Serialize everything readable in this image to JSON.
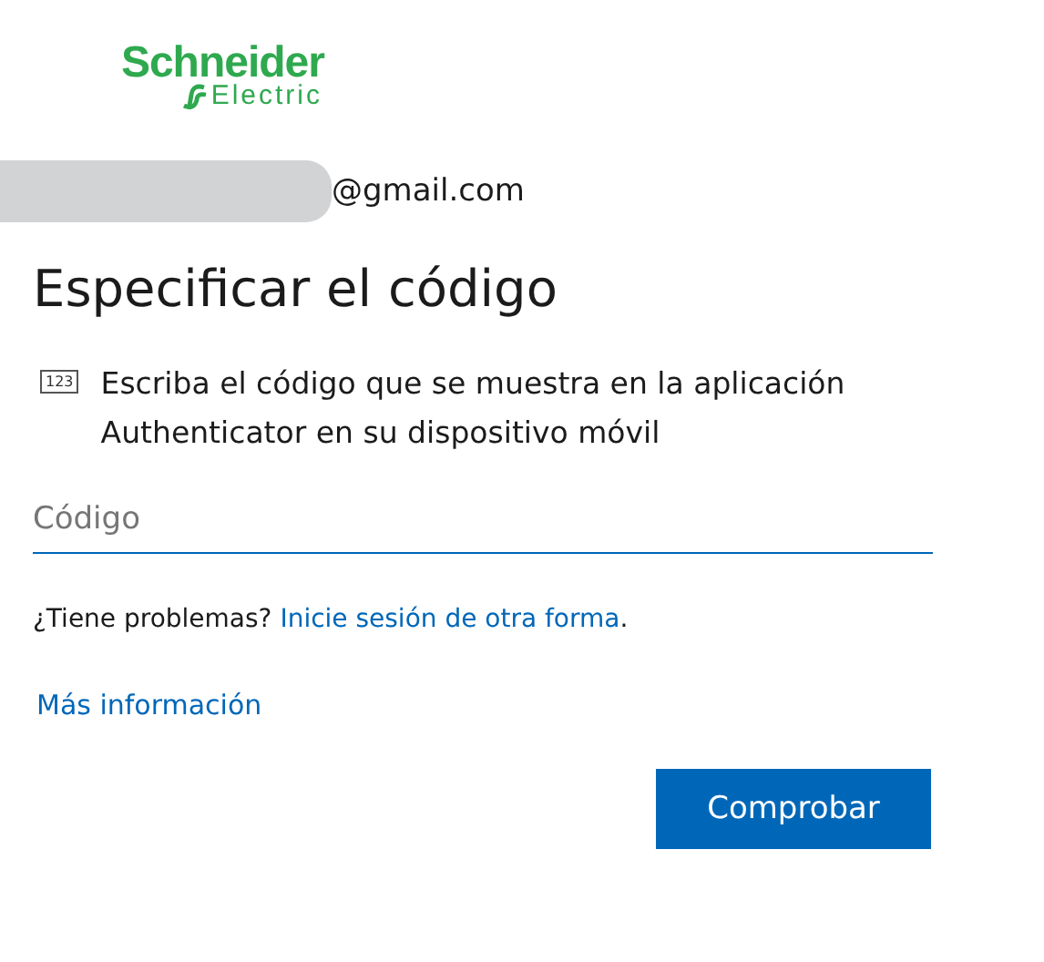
{
  "logo": {
    "name": "Schneider",
    "subname": "Electric"
  },
  "account": {
    "email": "@gmail.com"
  },
  "title": "Especificar el código",
  "instruction": {
    "icon_label": "123",
    "text": "Escriba el código que se muestra en la aplicación Authenticator en su dispositivo móvil"
  },
  "code_field": {
    "placeholder": "Código"
  },
  "trouble": {
    "text": "¿Tiene problemas?",
    "link": "Inicie sesión de otra forma",
    "end": "."
  },
  "more_info": "Más información",
  "buttons": [
    {
      "label": "Comprobar",
      "kind": "primary"
    }
  ]
}
